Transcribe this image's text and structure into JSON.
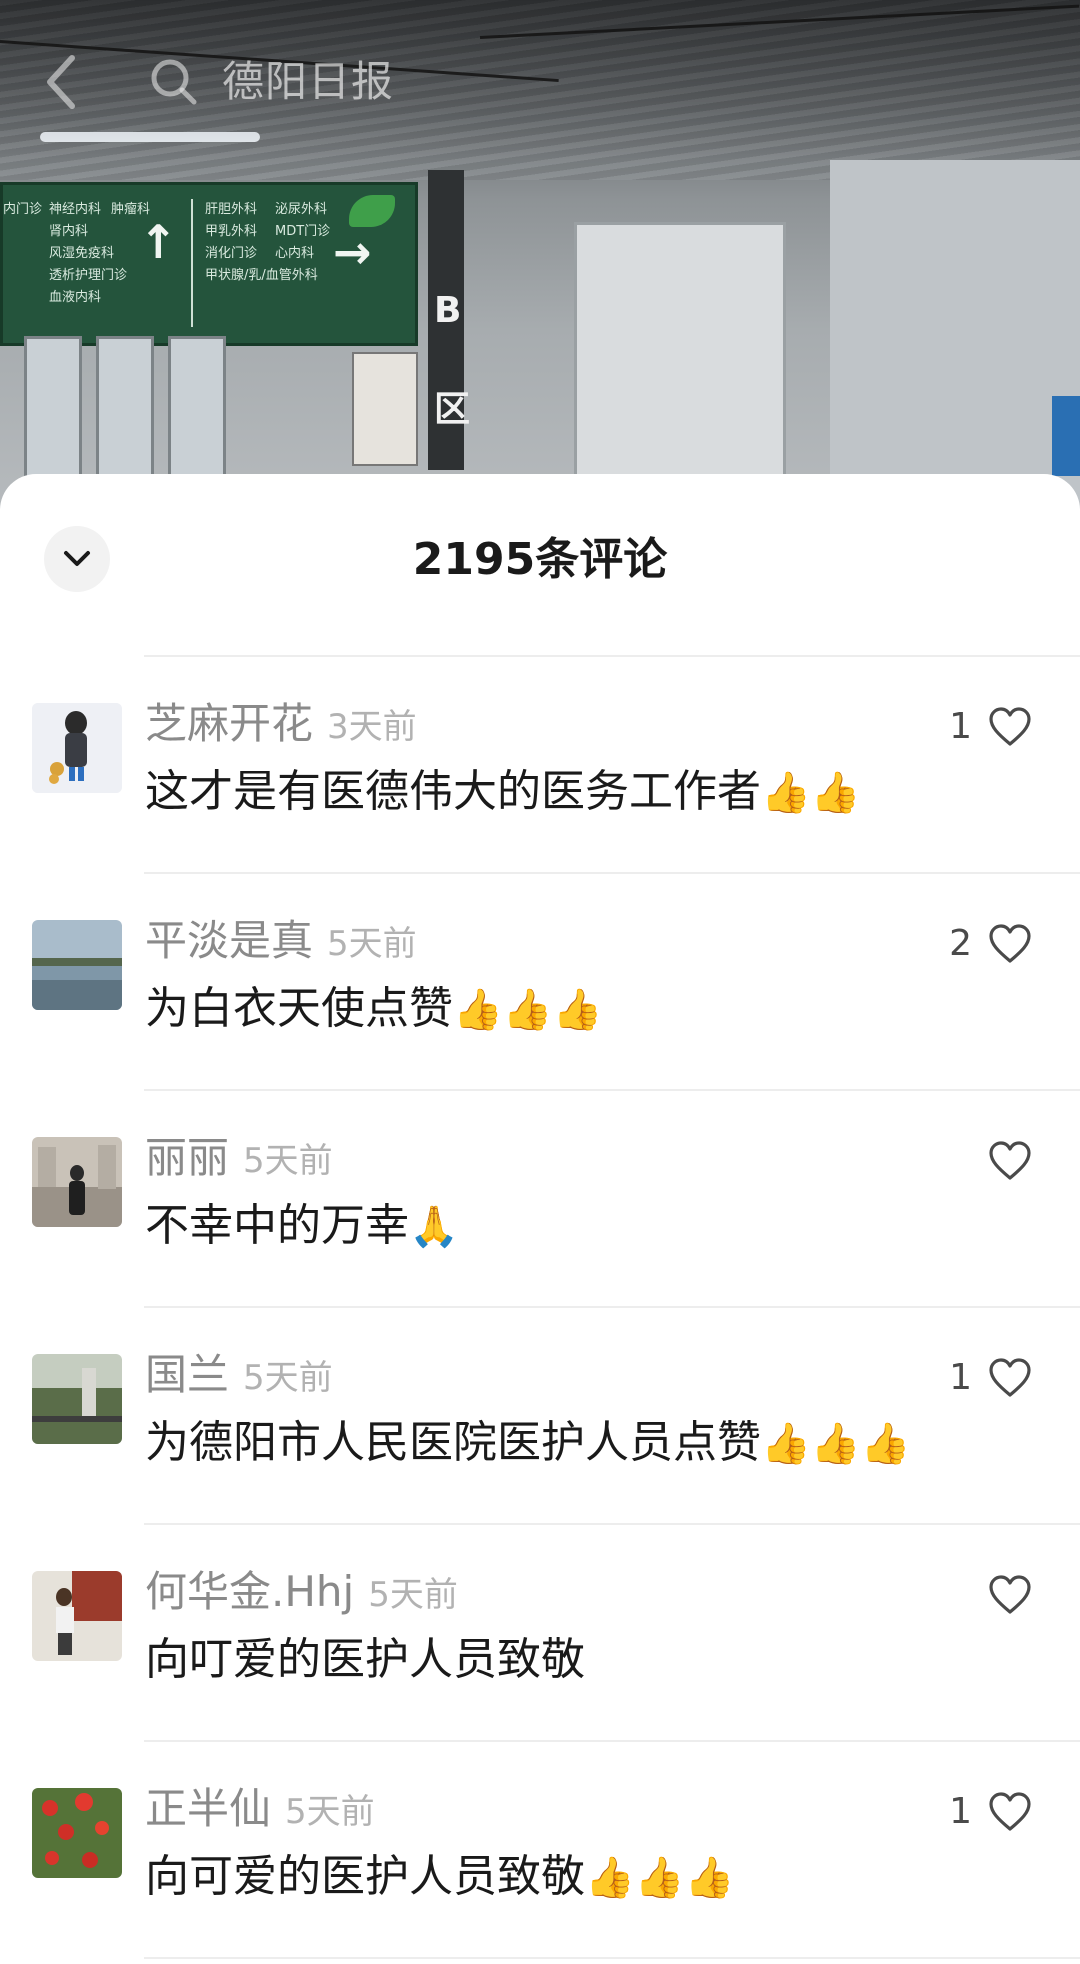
{
  "search": {
    "query": "德阳日报"
  },
  "comments_panel": {
    "title": "2195条评论"
  },
  "comments": [
    {
      "name": "芝麻开花",
      "time": "3天前",
      "text": "这才是有医德伟大的医务工作者",
      "emoji": "👍👍",
      "likes": "1"
    },
    {
      "name": "平淡是真",
      "time": "5天前",
      "text": "为白衣天使点赞",
      "emoji": "👍👍👍",
      "likes": "2"
    },
    {
      "name": "丽丽",
      "time": "5天前",
      "text": "不幸中的万幸",
      "emoji": "🙏",
      "likes": ""
    },
    {
      "name": "国兰",
      "time": "5天前",
      "text": "为德阳市人民医院医护人员点赞",
      "emoji": "👍👍👍",
      "likes": "1"
    },
    {
      "name": "何华金.Hhj",
      "time": "5天前",
      "text": "向叮爱的医护人员致敬",
      "emoji": "",
      "likes": ""
    },
    {
      "name": "正半仙",
      "time": "5天前",
      "text": "向可爱的医护人员致敬",
      "emoji": "👍👍👍",
      "likes": "1"
    }
  ],
  "background_sign": {
    "left_col_1": [
      "神经内科",
      "肾内科",
      "风湿免疫科",
      "透析护理门诊",
      "血液内科"
    ],
    "left_col_0": [
      "",
      "",
      "",
      "内门诊",
      ""
    ],
    "left_col_2": [
      "",
      "",
      "",
      "",
      "肿瘤科"
    ],
    "right_col_1": [
      "肝胆外科",
      "甲乳外科",
      "消化门诊",
      "甲状腺/乳/血管外科"
    ],
    "right_col_2": [
      "泌尿外科",
      "MDT门诊",
      "心内科",
      ""
    ],
    "panel_letters": [
      "B",
      "区"
    ]
  },
  "colors": {
    "sign_green": "#24543c",
    "sheet_bg": "#ffffff",
    "meta_gray": "#8a8a8a"
  }
}
